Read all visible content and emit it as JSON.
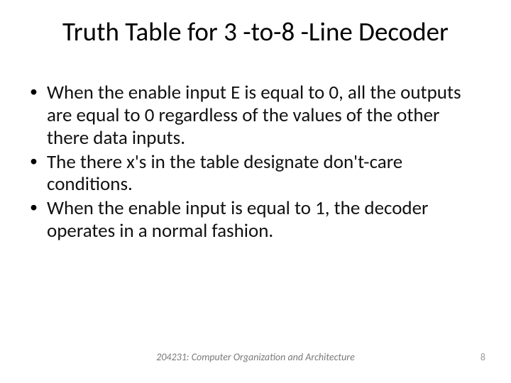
{
  "slide": {
    "title": "Truth Table for 3 -to-8 -Line Decoder",
    "bullets": [
      "When the enable input E is equal to 0, all the outputs are equal to 0 regardless of the values of the other there data inputs.",
      "The there x's in the table designate don't-care conditions.",
      "When the enable input is equal to 1, the decoder operates in a normal fashion."
    ],
    "footer": "204231: Computer Organization and Architecture",
    "page_number": "8"
  }
}
